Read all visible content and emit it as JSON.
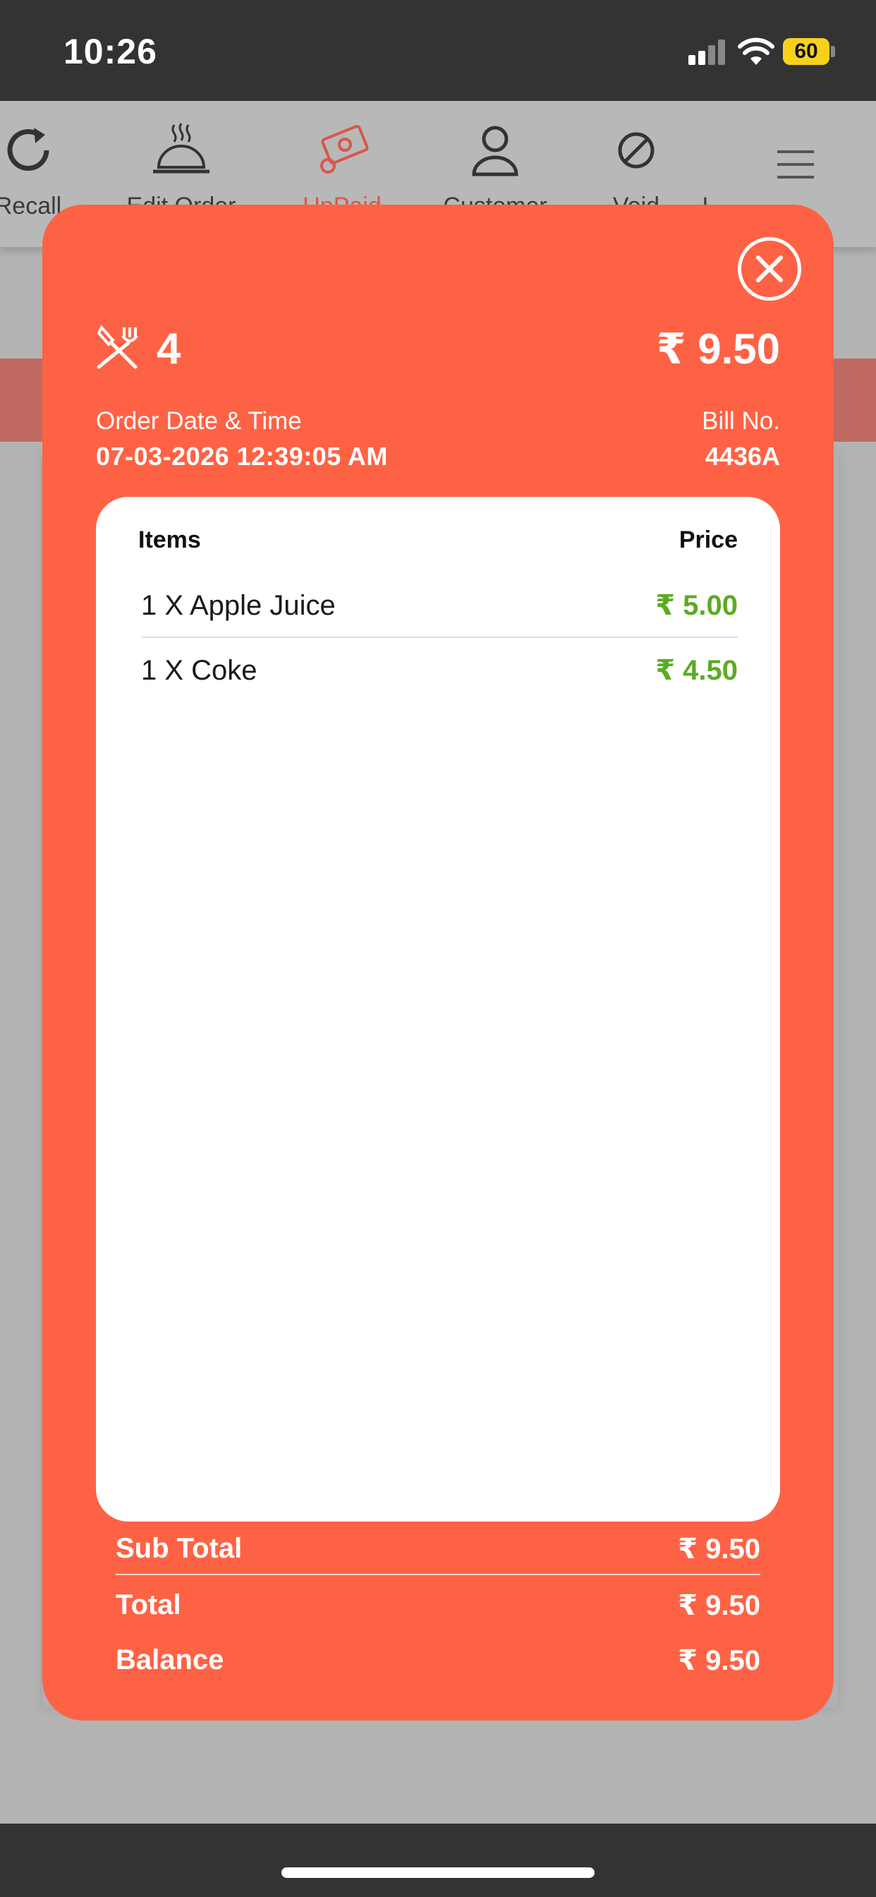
{
  "status_bar": {
    "time": "10:26",
    "battery": "60"
  },
  "toolbar": {
    "items": [
      {
        "label": "Recall",
        "icon": "refresh-icon"
      },
      {
        "label": "Edit Order",
        "icon": "cloche-icon"
      },
      {
        "label": "UnPaid",
        "icon": "cash-icon"
      },
      {
        "label": "Customer",
        "icon": "person-icon"
      },
      {
        "label": "Void",
        "icon": "void-icon"
      },
      {
        "label": "L",
        "icon": ""
      }
    ],
    "menu_icon": "hamburger-icon"
  },
  "modal": {
    "table_number": "4",
    "grand_total": "₹ 9.50",
    "order_date_label": "Order Date & Time",
    "order_date_value": "07-03-2026 12:39:05 AM",
    "bill_label": "Bill No.",
    "bill_value": "4436A",
    "items_header": "Items",
    "price_header": "Price",
    "items": [
      {
        "name": "1 X Apple Juice",
        "price": "₹ 5.00"
      },
      {
        "name": "1 X Coke",
        "price": "₹ 4.50"
      }
    ],
    "summary": [
      {
        "label": "Sub Total",
        "value": "₹ 9.50"
      },
      {
        "label": "Total",
        "value": "₹ 9.50"
      },
      {
        "label": "Balance",
        "value": "₹ 9.50"
      }
    ]
  },
  "colors": {
    "accent": "#fe6244",
    "price_green": "#5cab23",
    "bar_dark": "#333333"
  }
}
